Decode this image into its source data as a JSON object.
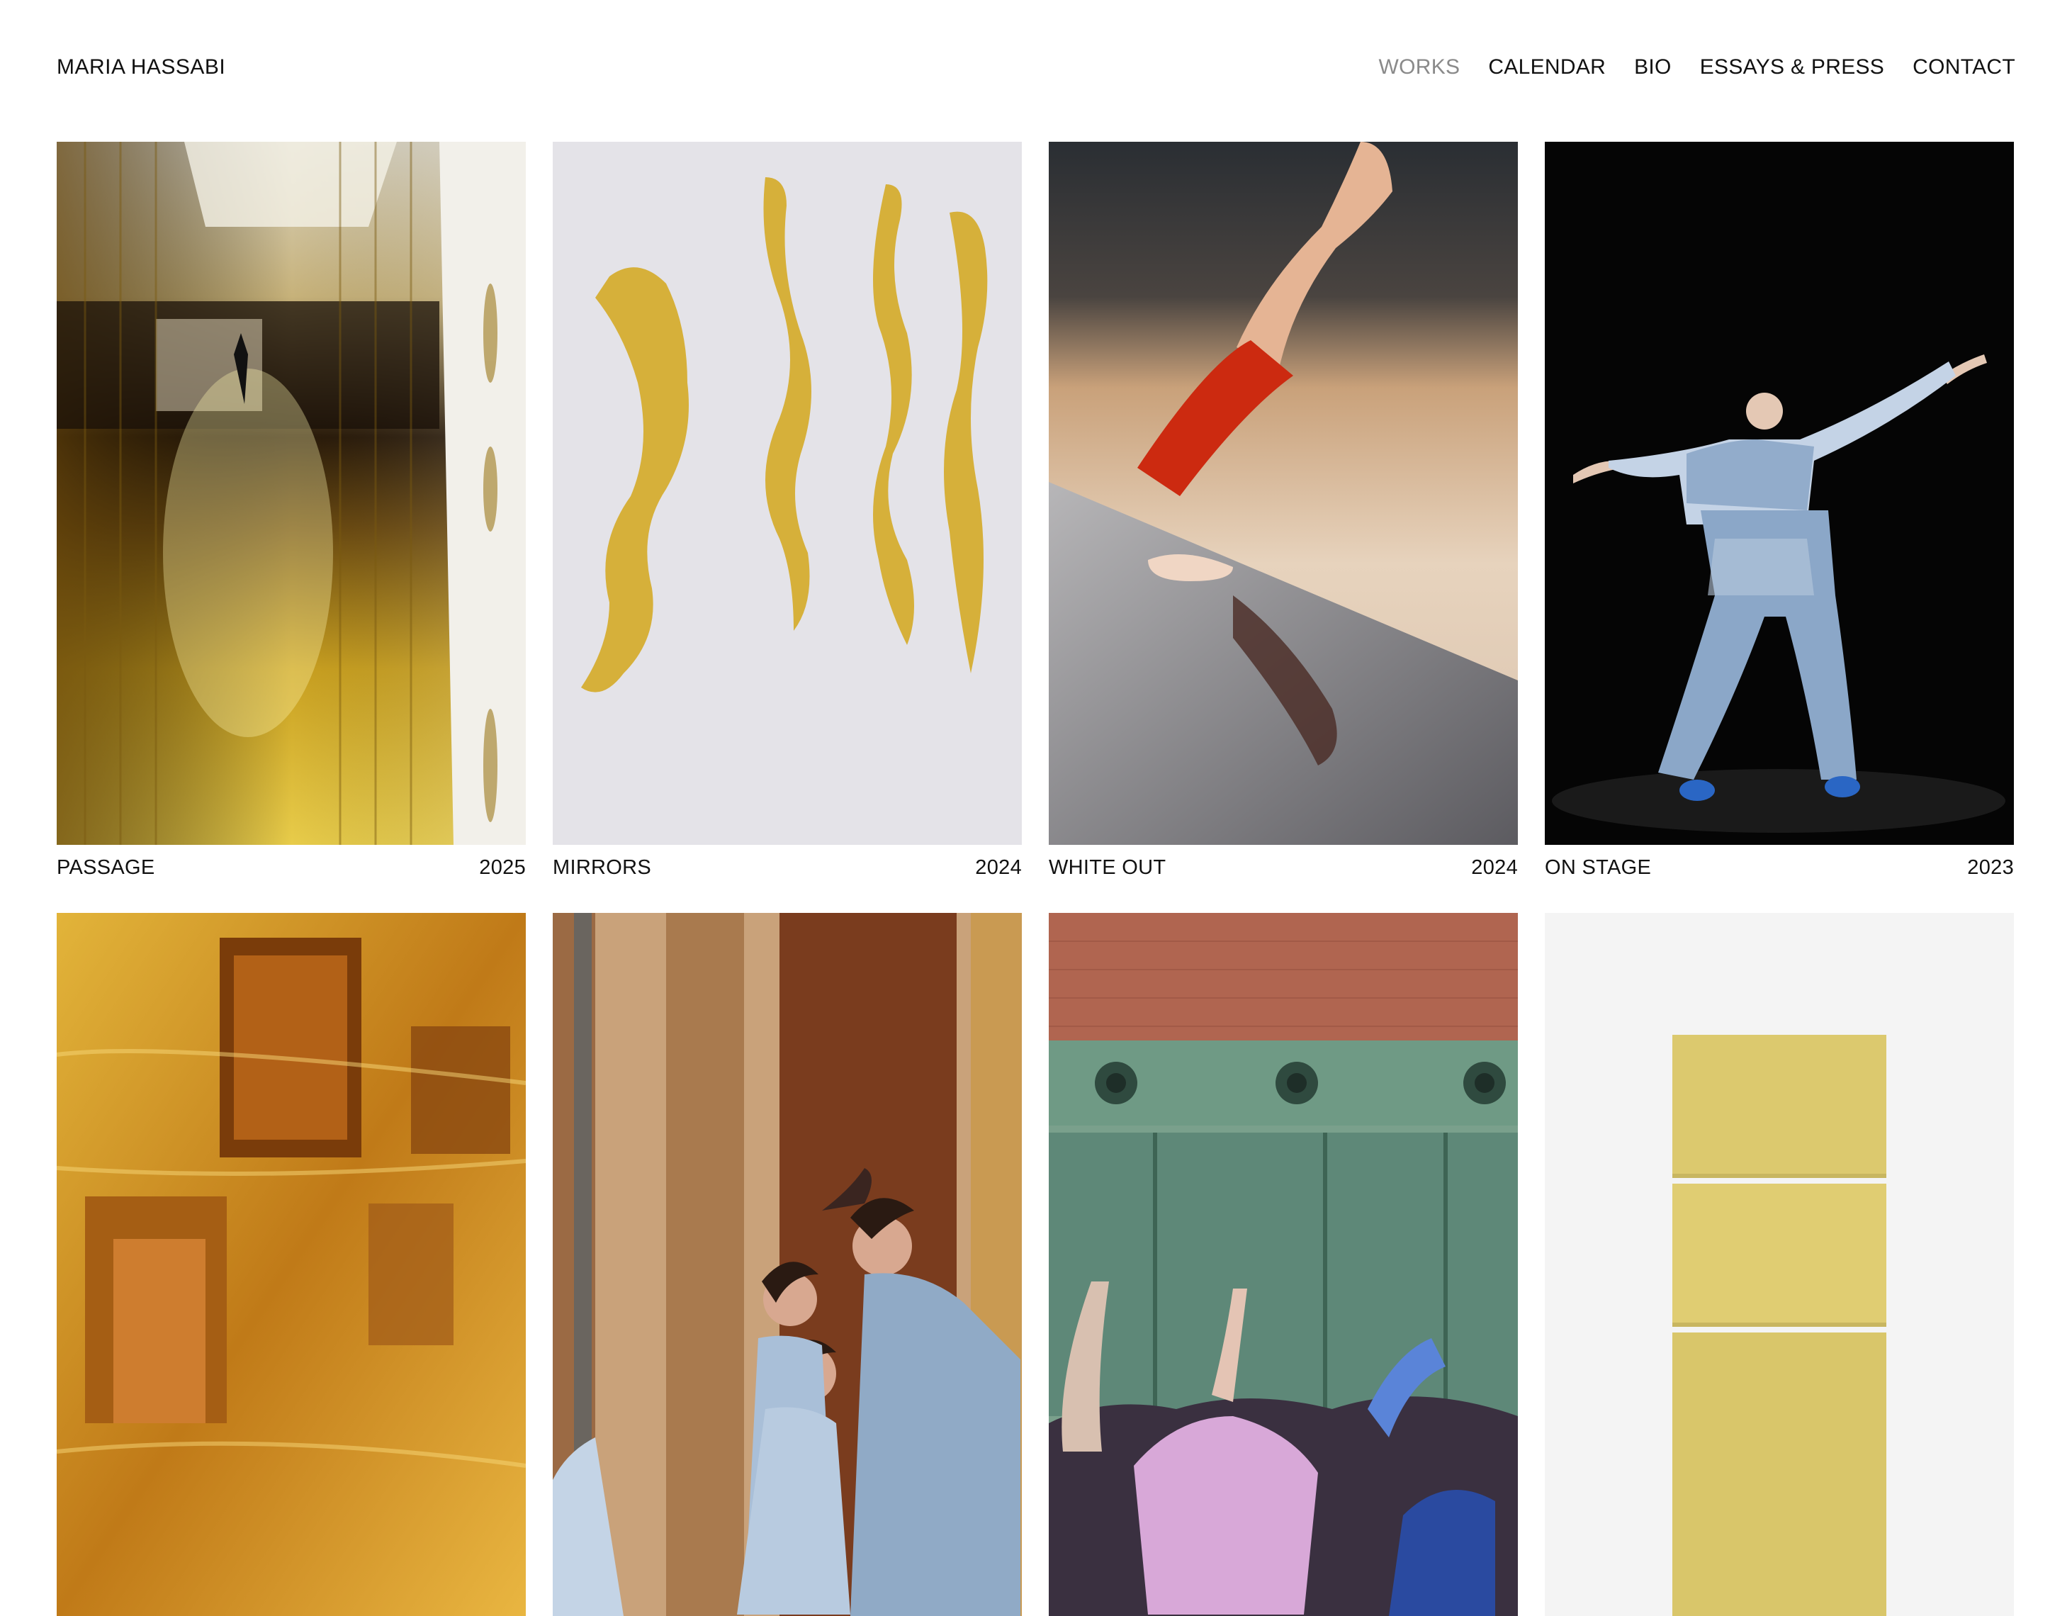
{
  "site": {
    "title": "MARIA HASSABI"
  },
  "nav": {
    "items": [
      {
        "label": "WORKS",
        "active": true
      },
      {
        "label": "CALENDAR",
        "active": false
      },
      {
        "label": "BIO",
        "active": false
      },
      {
        "label": "ESSAYS & PRESS",
        "active": false
      },
      {
        "label": "CONTACT",
        "active": false
      }
    ],
    "active_color": "#8a8a8a"
  },
  "works": [
    {
      "title": "PASSAGE",
      "year": "2025"
    },
    {
      "title": "MIRRORS",
      "year": "2024"
    },
    {
      "title": "WHITE OUT",
      "year": "2024"
    },
    {
      "title": "ON STAGE",
      "year": "2023"
    },
    {
      "title": "",
      "year": ""
    },
    {
      "title": "",
      "year": ""
    },
    {
      "title": "",
      "year": ""
    },
    {
      "title": "",
      "year": ""
    }
  ]
}
